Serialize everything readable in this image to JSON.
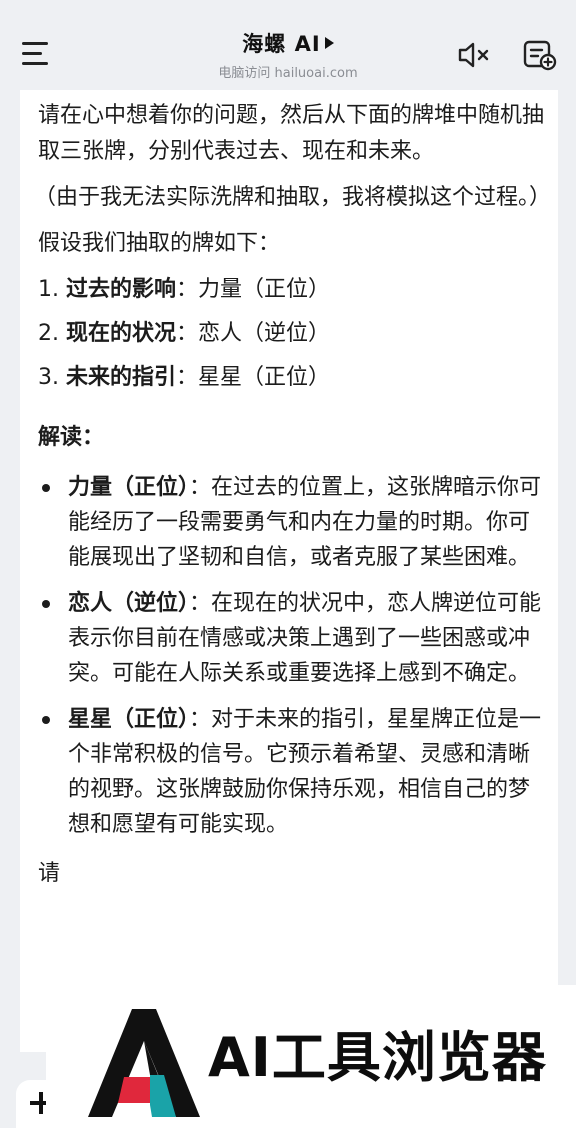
{
  "header": {
    "title": "海螺 AI",
    "subtitle": "电脑访问 hailuoai.com"
  },
  "icons": {
    "menu": "hamburger-menu-icon",
    "mute": "speaker-muted-icon",
    "new_chat": "new-chat-icon",
    "plus": "plus-icon"
  },
  "message": {
    "intro": "请在心中想着你的问题，然后从下面的牌堆中随机抽取三张牌，分别代表过去、现在和未来。",
    "note": "（由于我无法实际洗牌和抽取，我将模拟这个过程。）",
    "assume": "假设我们抽取的牌如下：",
    "draws": [
      {
        "num": "1.",
        "label": "过去的影响",
        "value": "：力量（正位）"
      },
      {
        "num": "2.",
        "label": "现在的状况",
        "value": "：恋人（逆位）"
      },
      {
        "num": "3.",
        "label": "未来的指引",
        "value": "：星星（正位）"
      }
    ],
    "interpret_heading": "解读：",
    "interpretations": [
      {
        "card": "力量（正位）",
        "text": "：在过去的位置上，这张牌暗示你可能经历了一段需要勇气和内在力量的时期。你可能展现出了坚韧和自信，或者克服了某些困难。"
      },
      {
        "card": "恋人（逆位）",
        "text": "：在现在的状况中，恋人牌逆位可能表示你目前在情感或决策上遇到了一些困惑或冲突。可能在人际关系或重要选择上感到不确定。"
      },
      {
        "card": "星星（正位）",
        "text": "：对于未来的指引，星星牌正位是一个非常积极的信号。它预示着希望、灵感和清晰的视野。这张牌鼓励你保持乐观，相信自己的梦想和愿望有可能实现。"
      }
    ],
    "cut_line": "请"
  },
  "watermark": {
    "text": "AI工具浏览器",
    "colors": {
      "dark": "#111111",
      "teal": "#1aa3a8",
      "red": "#e0283c"
    }
  }
}
